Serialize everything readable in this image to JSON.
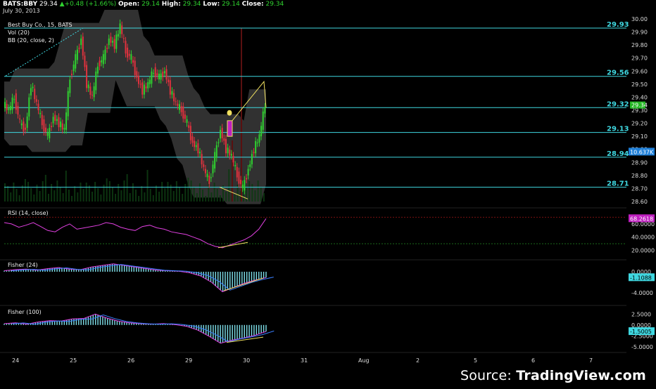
{
  "header": {
    "symbol": "BATS:BBY",
    "price": "29.34",
    "change": "+0.48 (+1.66%)",
    "open_label": "Open:",
    "open": "29.14",
    "high_label": "High:",
    "high": "29.34",
    "low_label": "Low:",
    "low": "29.14",
    "close_label": "Close:",
    "close": "29.34",
    "date": "July 30, 2013"
  },
  "studies": {
    "title": "Best Buy Co., 15, BATS",
    "vol": "Vol (20)",
    "bb": "BB (20, close, 2)",
    "rsi": "RSI (14, close)",
    "fisher1": "Fisher (24)",
    "fisher2": "Fisher (100)"
  },
  "source": {
    "prefix": "Source: ",
    "brand": "TradingView.com"
  },
  "colors": {
    "up": "#2fd12f",
    "down": "#e0323e",
    "level": "#3fd7e0",
    "band": "#3a3a3a",
    "rsi": "#e040e0",
    "annotation": "#f0e060",
    "fisher_bar": "#7fe0ea"
  },
  "chart_data": {
    "type": "candlestick",
    "x_tick_labels": [
      "24",
      "25",
      "26",
      "29",
      "30",
      "31",
      "Aug",
      "2",
      "5",
      "6",
      "7"
    ],
    "price_axis": {
      "ticks": [
        "30.00",
        "29.90",
        "29.80",
        "29.70",
        "29.60",
        "29.50",
        "29.40",
        "29.30",
        "29.20",
        "29.10",
        "29.00",
        "28.90",
        "28.80",
        "28.70",
        "28.60"
      ],
      "ylim": [
        28.6,
        30.0
      ]
    },
    "levels": [
      29.93,
      29.56,
      29.32,
      29.13,
      28.94,
      28.71
    ],
    "level_labels": [
      "29.93",
      "29.56",
      "29.32",
      "29.13",
      "28.94",
      "28.71"
    ],
    "last_price_label": "29.34",
    "volume_label": "10.637K",
    "rsi_axis": {
      "ticks": [
        "60.0000",
        "40.0000",
        "20.0000"
      ],
      "last_label": "68.2618",
      "ylim": [
        10,
        80
      ]
    },
    "fisher1_axis": {
      "ticks": [
        "0.0000",
        "-4.0000"
      ],
      "last_label": "-1.1088",
      "ylim": [
        -6,
        2
      ]
    },
    "fisher2_axis": {
      "ticks": [
        "2.5000",
        "0.0000",
        "-2.5000",
        "-5.0000"
      ],
      "last_label": "-1.5005",
      "ylim": [
        -6,
        4
      ]
    },
    "price_path": [
      29.35,
      29.3,
      29.4,
      29.2,
      29.15,
      29.5,
      29.35,
      29.2,
      29.1,
      29.25,
      29.2,
      29.15,
      29.55,
      29.7,
      29.85,
      29.5,
      29.4,
      29.65,
      29.7,
      29.85,
      29.8,
      29.95,
      29.75,
      29.7,
      29.55,
      29.45,
      29.5,
      29.6,
      29.55,
      29.6,
      29.45,
      29.35,
      29.3,
      29.2,
      29.05,
      29.0,
      28.85,
      28.75,
      28.95,
      29.15,
      29.0,
      28.95,
      28.8,
      28.7,
      28.85,
      29.0,
      29.1,
      29.34
    ],
    "rsi_path": [
      62,
      60,
      55,
      58,
      62,
      56,
      50,
      48,
      55,
      60,
      52,
      54,
      56,
      58,
      62,
      60,
      55,
      52,
      50,
      56,
      58,
      54,
      52,
      48,
      46,
      44,
      40,
      36,
      30,
      26,
      24,
      28,
      32,
      36,
      42,
      52,
      68
    ],
    "fisher1_path": [
      0.2,
      0.4,
      0.5,
      0.3,
      0.6,
      0.8,
      0.5,
      0.4,
      0.9,
      1.2,
      1.5,
      1.2,
      0.9,
      0.6,
      0.3,
      0.2,
      0.1,
      -0.2,
      -0.8,
      -2.0,
      -3.8,
      -3.0,
      -2.2,
      -1.6,
      -1.1
    ],
    "fisher2_path": [
      0.3,
      0.5,
      0.2,
      0.7,
      1.0,
      0.9,
      1.4,
      1.5,
      2.5,
      1.6,
      0.9,
      0.5,
      0.3,
      0.2,
      0.3,
      0.1,
      -0.3,
      -1.2,
      -2.6,
      -4.2,
      -3.5,
      -3.0,
      -2.4,
      -1.5
    ]
  }
}
